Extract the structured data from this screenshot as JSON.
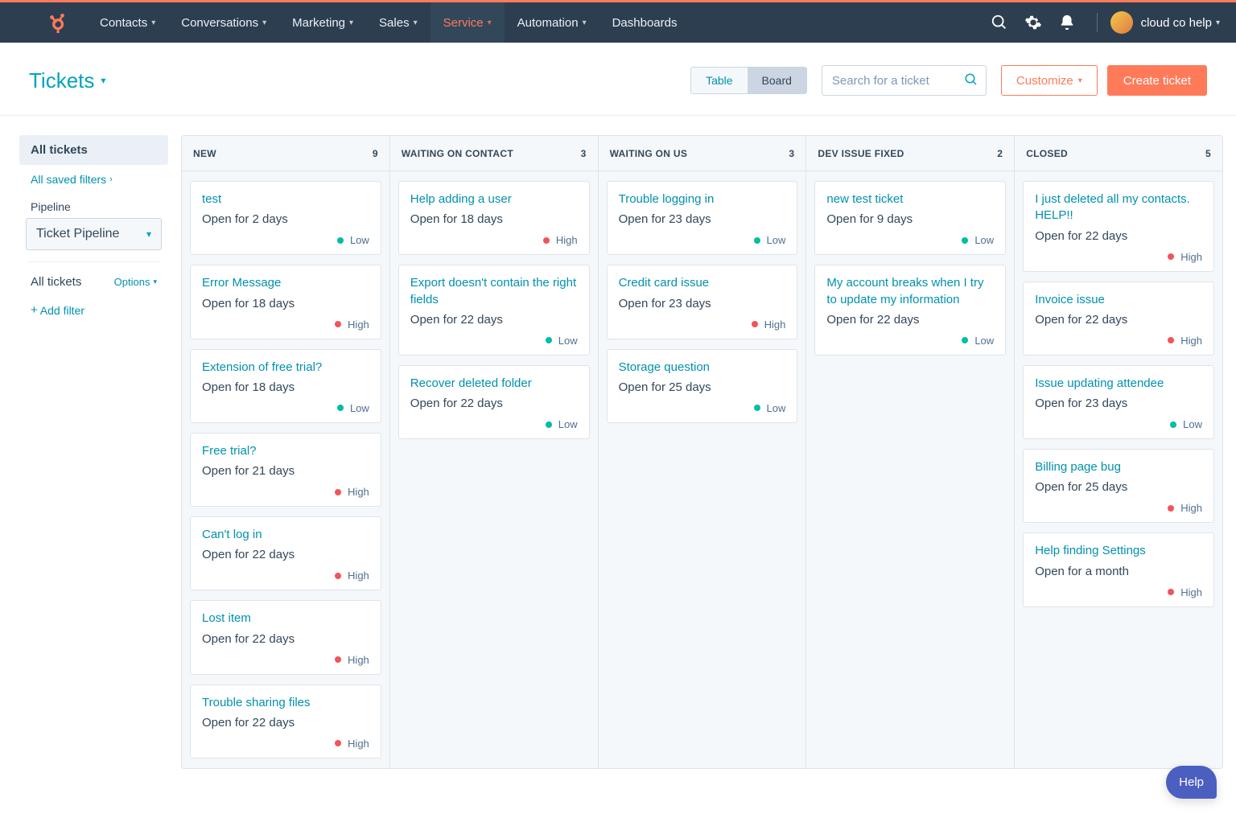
{
  "nav": {
    "items": [
      {
        "label": "Contacts",
        "hasChevron": true
      },
      {
        "label": "Conversations",
        "hasChevron": true
      },
      {
        "label": "Marketing",
        "hasChevron": true
      },
      {
        "label": "Sales",
        "hasChevron": true
      },
      {
        "label": "Service",
        "hasChevron": true,
        "active": true
      },
      {
        "label": "Automation",
        "hasChevron": true
      },
      {
        "label": "Dashboards",
        "hasChevron": false
      }
    ],
    "account": "cloud co help"
  },
  "header": {
    "title": "Tickets",
    "toggle": {
      "table": "Table",
      "board": "Board"
    },
    "search_placeholder": "Search for a ticket",
    "customize": "Customize",
    "create": "Create ticket"
  },
  "sidebar": {
    "all_tickets": "All tickets",
    "saved_filters": "All saved filters",
    "pipeline_label": "Pipeline",
    "pipeline_value": "Ticket Pipeline",
    "filter_name": "All tickets",
    "options": "Options",
    "add_filter": "Add filter"
  },
  "priority_labels": {
    "low": "Low",
    "high": "High"
  },
  "columns": [
    {
      "name": "NEW",
      "count": 9,
      "cards": [
        {
          "title": "test",
          "sub": "Open for 2 days",
          "prio": "low"
        },
        {
          "title": "Error Message",
          "sub": "Open for 18 days",
          "prio": "high"
        },
        {
          "title": "Extension of free trial?",
          "sub": "Open for 18 days",
          "prio": "low"
        },
        {
          "title": "Free trial?",
          "sub": "Open for 21 days",
          "prio": "high"
        },
        {
          "title": "Can't log in",
          "sub": "Open for 22 days",
          "prio": "high"
        },
        {
          "title": "Lost item",
          "sub": "Open for 22 days",
          "prio": "high"
        },
        {
          "title": "Trouble sharing files",
          "sub": "Open for 22 days",
          "prio": "high"
        }
      ]
    },
    {
      "name": "WAITING ON CONTACT",
      "count": 3,
      "cards": [
        {
          "title": "Help adding a user",
          "sub": "Open for 18 days",
          "prio": "high"
        },
        {
          "title": "Export doesn't contain the right fields",
          "sub": "Open for 22 days",
          "prio": "low"
        },
        {
          "title": "Recover deleted folder",
          "sub": "Open for 22 days",
          "prio": "low"
        }
      ]
    },
    {
      "name": "WAITING ON US",
      "count": 3,
      "cards": [
        {
          "title": "Trouble logging in",
          "sub": "Open for 23 days",
          "prio": "low"
        },
        {
          "title": "Credit card issue",
          "sub": "Open for 23 days",
          "prio": "high"
        },
        {
          "title": "Storage question",
          "sub": "Open for 25 days",
          "prio": "low"
        }
      ]
    },
    {
      "name": "DEV ISSUE FIXED",
      "count": 2,
      "cards": [
        {
          "title": "new test ticket",
          "sub": "Open for 9 days",
          "prio": "low"
        },
        {
          "title": "My account breaks when I try to update my information",
          "sub": "Open for 22 days",
          "prio": "low"
        }
      ]
    },
    {
      "name": "CLOSED",
      "count": 5,
      "cards": [
        {
          "title": "I just deleted all my contacts. HELP!!",
          "sub": "Open for 22 days",
          "prio": "high"
        },
        {
          "title": "Invoice issue",
          "sub": "Open for 22 days",
          "prio": "high"
        },
        {
          "title": "Issue updating attendee",
          "sub": "Open for 23 days",
          "prio": "low"
        },
        {
          "title": "Billing page bug",
          "sub": "Open for 25 days",
          "prio": "high"
        },
        {
          "title": "Help finding Settings",
          "sub": "Open for a month",
          "prio": "high"
        }
      ]
    }
  ],
  "help_fab": "Help"
}
